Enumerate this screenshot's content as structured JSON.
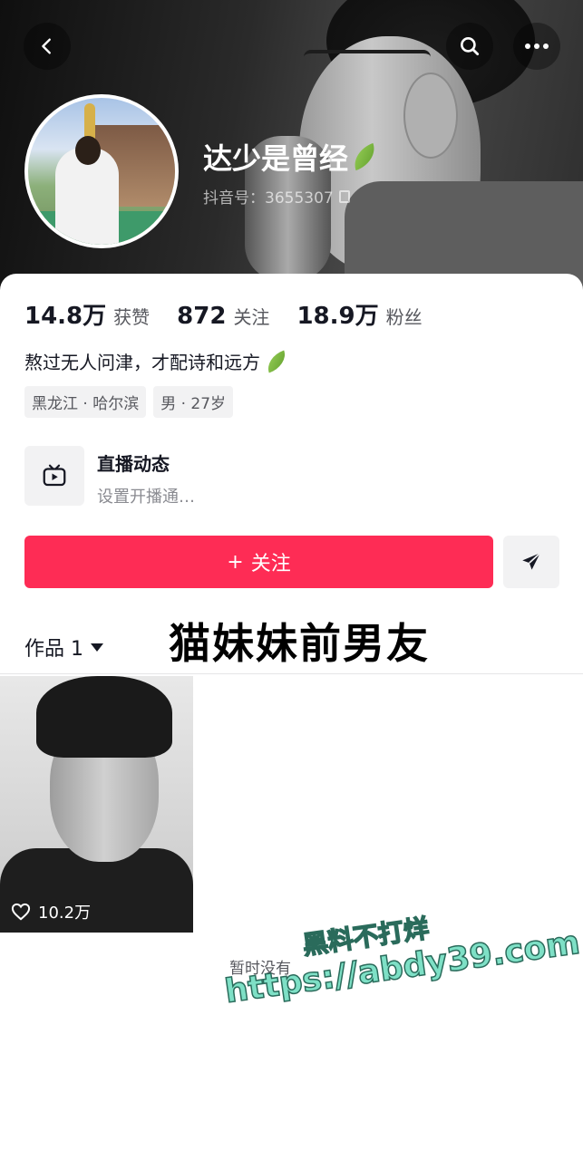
{
  "profile": {
    "name": "达少是曾经",
    "douyin_id": "抖音号：3655307",
    "bio": "熬过无人问津，才配诗和远方",
    "tags": [
      "黑龙江 · 哈尔滨",
      "男 · 27岁"
    ]
  },
  "stats": [
    {
      "value": "14.8万",
      "label": "获赞"
    },
    {
      "value": "872",
      "label": "关注"
    },
    {
      "value": "18.9万",
      "label": "粉丝"
    }
  ],
  "live": {
    "title": "直播动态",
    "subtitle": "设置开播通…"
  },
  "actions": {
    "follow_label": "关注",
    "follow_icon": "+"
  },
  "works": {
    "tab_label": "作品 1",
    "caption_overlay": "猫妹妹前男友",
    "videos": [
      {
        "likes": "10.2万"
      }
    ],
    "empty_text": "暂时没有"
  },
  "watermark": {
    "line1": "黑料不打烊",
    "line2": "https://abdy39.com"
  },
  "colors": {
    "follow_button": "#fe2c55",
    "text_primary": "#161823",
    "text_secondary": "#57585e",
    "tag_bg": "#f2f2f3",
    "watermark": "#7ee0c6"
  },
  "icons": {
    "back": "chevron-left-icon",
    "search": "search-icon",
    "more": "more-horizontal-icon",
    "live": "tv-icon",
    "share": "send-icon",
    "like": "heart-icon",
    "copy": "copy-icon"
  }
}
